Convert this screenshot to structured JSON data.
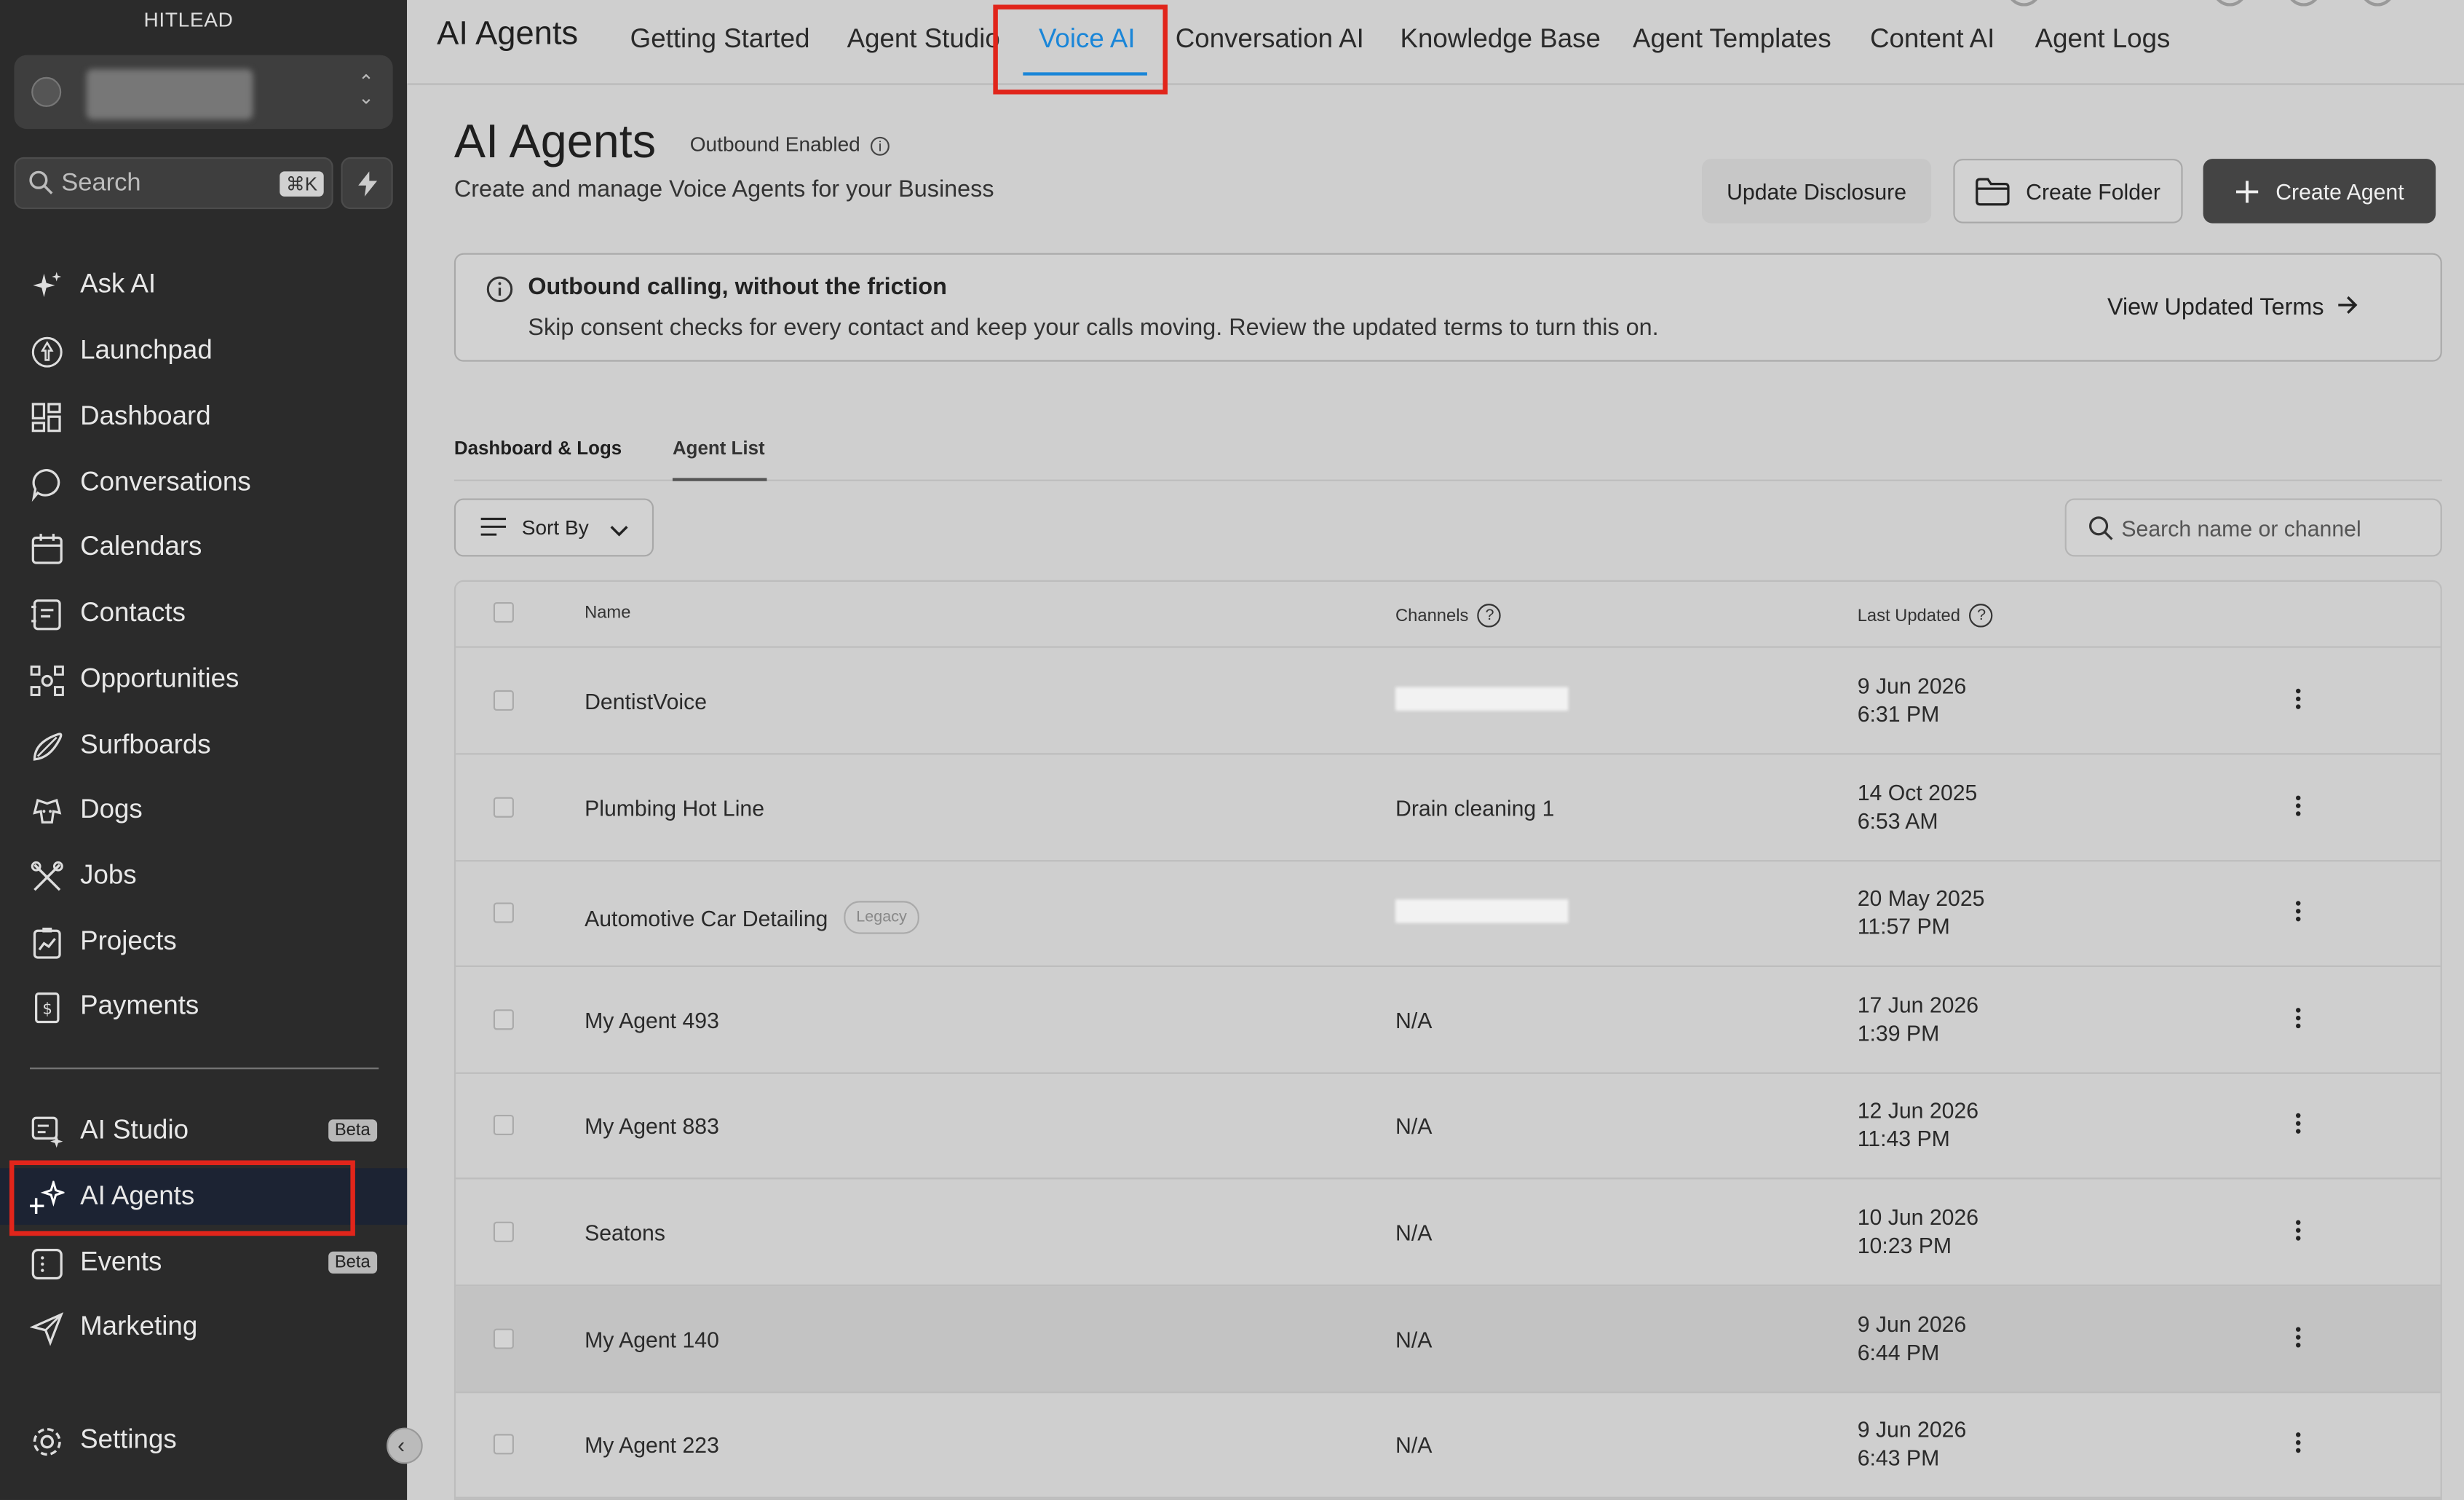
{
  "sidebar": {
    "brand": "HITLEAD",
    "search": {
      "placeholder": "Search",
      "shortcut": "⌘K"
    },
    "items": [
      {
        "label": "Ask AI",
        "icon": "sparkle-icon"
      },
      {
        "label": "Launchpad",
        "icon": "rocket-icon"
      },
      {
        "label": "Dashboard",
        "icon": "grid-icon"
      },
      {
        "label": "Conversations",
        "icon": "chat-bubble-icon"
      },
      {
        "label": "Calendars",
        "icon": "calendar-icon"
      },
      {
        "label": "Contacts",
        "icon": "contact-book-icon"
      },
      {
        "label": "Opportunities",
        "icon": "funnel-network-icon"
      },
      {
        "label": "Surfboards",
        "icon": "surfboard-icon"
      },
      {
        "label": "Dogs",
        "icon": "dog-icon"
      },
      {
        "label": "Jobs",
        "icon": "tools-icon"
      },
      {
        "label": "Projects",
        "icon": "clipboard-chart-icon"
      },
      {
        "label": "Payments",
        "icon": "receipt-dollar-icon"
      }
    ],
    "lower_items": [
      {
        "label": "AI Studio",
        "badge": "Beta",
        "icon": "ai-studio-icon"
      },
      {
        "label": "AI Agents",
        "badge": "",
        "icon": "ai-sparkle-icon"
      },
      {
        "label": "Events",
        "badge": "Beta",
        "icon": "events-icon"
      },
      {
        "label": "Marketing",
        "badge": "",
        "icon": "paper-plane-icon"
      }
    ],
    "settings_label": "Settings"
  },
  "topnav": {
    "title": "AI Agents",
    "tabs": [
      "Getting Started",
      "Agent Studio",
      "Voice AI",
      "Conversation AI",
      "Knowledge Base",
      "Agent Templates",
      "Content AI",
      "Agent Logs"
    ],
    "active_tab": "Voice AI"
  },
  "page": {
    "title": "AI Agents",
    "status": "Outbound Enabled",
    "subtitle": "Create and manage Voice Agents for your Business",
    "buttons": {
      "update_disclosure": "Update Disclosure",
      "create_folder": "Create Folder",
      "create_agent": "Create Agent"
    }
  },
  "banner": {
    "title": "Outbound calling, without the friction",
    "body": "Skip consent checks for every contact and keep your calls moving. Review the updated terms to turn this on.",
    "link": "View Updated Terms"
  },
  "subtabs": [
    "Dashboard & Logs",
    "Agent List"
  ],
  "toolbar": {
    "sort_label": "Sort By",
    "search_placeholder": "Search name or channel"
  },
  "table": {
    "columns": {
      "name": "Name",
      "channels": "Channels",
      "last_updated": "Last Updated"
    },
    "rows": [
      {
        "name": "DentistVoice",
        "channel": "",
        "channel_redacted": true,
        "date": "9 Jun 2026",
        "time": "6:31 PM",
        "badge": ""
      },
      {
        "name": "Plumbing Hot Line",
        "channel": "Drain cleaning 1",
        "channel_redacted": false,
        "date": "14 Oct 2025",
        "time": "6:53 AM",
        "badge": ""
      },
      {
        "name": "Automotive Car Detailing",
        "channel": "",
        "channel_redacted": true,
        "date": "20 May 2025",
        "time": "11:57 PM",
        "badge": "Legacy"
      },
      {
        "name": "My Agent 493",
        "channel": "N/A",
        "channel_redacted": false,
        "date": "17 Jun 2026",
        "time": "1:39 PM",
        "badge": ""
      },
      {
        "name": "My Agent 883",
        "channel": "N/A",
        "channel_redacted": false,
        "date": "12 Jun 2026",
        "time": "11:43 PM",
        "badge": ""
      },
      {
        "name": "Seatons",
        "channel": "N/A",
        "channel_redacted": false,
        "date": "10 Jun 2026",
        "time": "10:23 PM",
        "badge": ""
      },
      {
        "name": "My Agent 140",
        "channel": "N/A",
        "channel_redacted": false,
        "date": "9 Jun 2026",
        "time": "6:44 PM",
        "badge": ""
      },
      {
        "name": "My Agent 223",
        "channel": "N/A",
        "channel_redacted": false,
        "date": "9 Jun 2026",
        "time": "6:43 PM",
        "badge": ""
      }
    ]
  },
  "colors": {
    "accent": "#1a86d8",
    "highlight": "#e1251b",
    "sidebar_bg": "#2b2b2b",
    "active_nav_bg": "#1c2333",
    "primary_button": "#444444"
  }
}
